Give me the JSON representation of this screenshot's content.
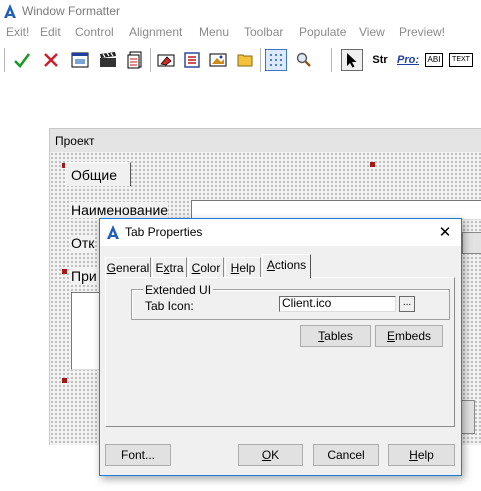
{
  "window": {
    "title": "Window Formatter"
  },
  "menu": {
    "items": [
      {
        "label": "Exit!"
      },
      {
        "label": "Edit"
      },
      {
        "label": "Control"
      },
      {
        "label": "Alignment"
      },
      {
        "label": "Menu"
      },
      {
        "label": "Toolbar"
      },
      {
        "label": "Populate"
      },
      {
        "label": "View"
      },
      {
        "label": "Preview!"
      }
    ]
  },
  "toolbar": {
    "string_label": "Str",
    "prompt_label": "Pro:",
    "entry_label": "ABI",
    "text_label": "TEXT",
    "accent_color": "#3b78c8"
  },
  "designer": {
    "title": "Проект",
    "tab_label": "Общие",
    "name_label": "Наименование",
    "open_label": "Отк",
    "note_label": "При",
    "handle_color": "#a01818"
  },
  "dialog": {
    "title": "Tab Properties",
    "close_glyph": "✕",
    "tabs": [
      {
        "label": "General",
        "underline": "G",
        "rest": "eneral"
      },
      {
        "label": "Extra",
        "pre": "E",
        "underline": "x",
        "rest": "tra"
      },
      {
        "label": "Color",
        "underline": "C",
        "rest": "olor"
      },
      {
        "label": "Help",
        "underline": "H",
        "rest": "elp"
      },
      {
        "label": "Actions",
        "underline": "A",
        "rest": "ctions"
      }
    ],
    "active_tab": "Actions",
    "group_title": "Extended UI",
    "tab_icon_label": "Tab Icon:",
    "tab_icon_value": "Client.ico",
    "ellipsis": "...",
    "tables_button": {
      "underline": "T",
      "rest": "ables"
    },
    "embeds_button": {
      "underline": "E",
      "rest": "mbeds"
    },
    "font_button": {
      "label": "Font..."
    },
    "ok_button": {
      "underline": "O",
      "rest": "K"
    },
    "cancel_button": {
      "label": "Cancel"
    },
    "help_button": {
      "underline": "H",
      "rest": "elp"
    },
    "border_color": "#1a7ee0"
  }
}
